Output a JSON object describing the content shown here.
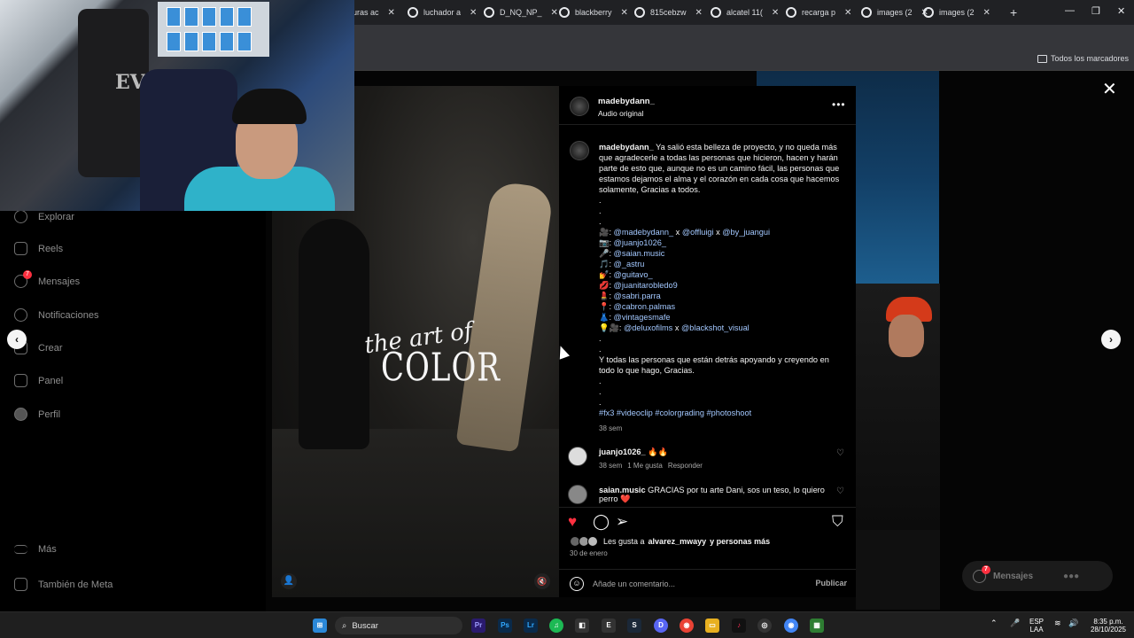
{
  "browser": {
    "tabs": [
      {
        "label": "uras ac"
      },
      {
        "label": "luchador a"
      },
      {
        "label": "D_NQ_NP_"
      },
      {
        "label": "blackberry"
      },
      {
        "label": "815cebzw"
      },
      {
        "label": "alcatel 11("
      },
      {
        "label": "recarga p"
      },
      {
        "label": "images (2"
      },
      {
        "label": "images (2"
      }
    ],
    "new_tab": "+",
    "bookmarks_all": "Todos los marcadores"
  },
  "sidebar": {
    "items": [
      {
        "label": "Explorar",
        "icon": "compass-icon"
      },
      {
        "label": "Reels",
        "icon": "reels-icon"
      },
      {
        "label": "Mensajes",
        "icon": "messenger-icon",
        "badge": "7"
      },
      {
        "label": "Notificaciones",
        "icon": "heart-icon"
      },
      {
        "label": "Crear",
        "icon": "plus-icon"
      },
      {
        "label": "Panel",
        "icon": "chart-icon"
      },
      {
        "label": "Perfil",
        "icon": "profile-icon"
      }
    ],
    "more": "Más",
    "meta": "También de Meta"
  },
  "post": {
    "username": "madebydann_",
    "audio": "Audio original",
    "media_title_1": "the art of",
    "media_title_2": "COLOR",
    "caption_intro": "Ya salió esta belleza de proyecto, y no queda más que agradecerle a todas las personas que hicieron, hacen y harán parte de esto que, aunque no es un camino fácil, las personas que estamos dejamos el alma y el corazón en cada cosa que hacemos solamente, Gracias a todos.",
    "credits": [
      {
        "icon": "🎥",
        "mentions": [
          "@madebydann_",
          "@offluigi",
          "@by_juangui"
        ]
      },
      {
        "icon": "📷",
        "mentions": [
          "@juanjo1026_"
        ]
      },
      {
        "icon": "🎤",
        "mentions": [
          "@saian.music"
        ]
      },
      {
        "icon": "🎵",
        "mentions": [
          "@_astru"
        ]
      },
      {
        "icon": "💅",
        "mentions": [
          "@guitavo_"
        ]
      },
      {
        "icon": "💋",
        "mentions": [
          "@juanitarobledo9"
        ]
      },
      {
        "icon": "💄",
        "mentions": [
          "@sabri.parra"
        ]
      },
      {
        "icon": "📍",
        "mentions": [
          "@cabron.palmas"
        ]
      },
      {
        "icon": "👗",
        "mentions": [
          "@vintagesmafe"
        ]
      },
      {
        "icon": "💡🎥",
        "mentions": [
          "@deluxofilms",
          "@blackshot_visual"
        ]
      }
    ],
    "closing": "Y todas las personas que están detrás apoyando y creyendo en todo lo que hago, Gracias.",
    "hashtags": "#fx3 #videoclip #colorgrading #photoshoot",
    "time": "38 sem",
    "comments": [
      {
        "user": "juanjo1026_",
        "text": "🔥🔥",
        "time": "38 sem",
        "likes": "1 Me gusta",
        "reply": "Responder"
      },
      {
        "user": "saian.music",
        "text": "GRACIAS por tu arte Dani, sos un teso, lo quiero perro ❤️"
      }
    ],
    "likes_text_prefix": "Les gusta a",
    "likes_user": "alvarez_mwayy",
    "likes_suffix": "y personas más",
    "date": "30 de enero",
    "comment_placeholder": "Añade un comentario...",
    "publish": "Publicar"
  },
  "overlay": {
    "messages_pill": "Mensajes",
    "messages_badge": "7"
  },
  "taskbar": {
    "search": "Buscar",
    "lang": "ESP",
    "lang2": "LAA",
    "time": "8:35 p.m.",
    "date": "28/10/2025"
  },
  "colors": {
    "link": "#a3c8ff",
    "like_red": "#ff3040",
    "panel_bg": "#000000",
    "muted": "#a8a8a8"
  }
}
